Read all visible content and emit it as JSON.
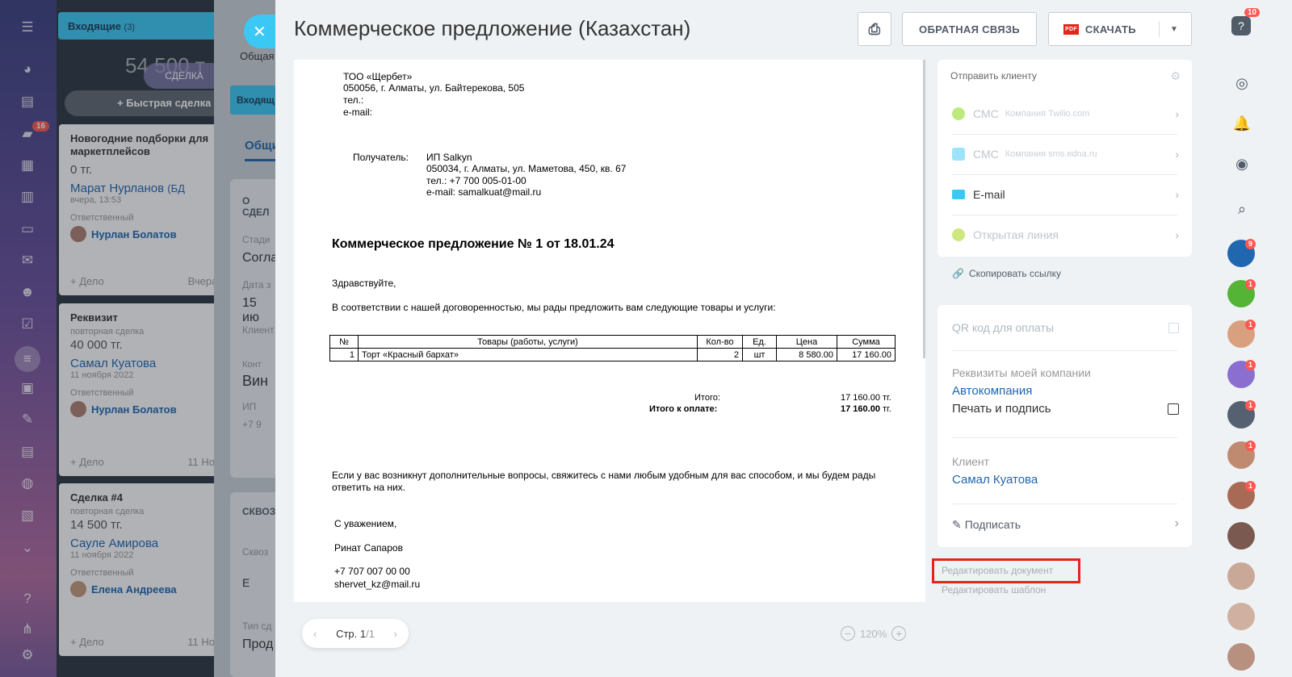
{
  "nav": {
    "chat_badge": "16"
  },
  "kanban": {
    "column_title": "Входящие",
    "column_count": "(3)",
    "sum": "54 500 т",
    "sum_pill": "СДЕЛКА",
    "quick_add": "+ Быстрая сделка",
    "cards": [
      {
        "title": "Новогодние подборки для маркетплейсов",
        "sub": "",
        "price": "0 тг.",
        "client": "Марат Нурланов",
        "client_extra": "(БД",
        "date": "вчера, 13:53",
        "resp_label": "Ответственный",
        "resp": "Нурлан Болатов",
        "footer_left": "+ Дело",
        "footer_right": "Вчера,"
      },
      {
        "title": "Реквизит",
        "sub": "повторная сделка",
        "price": "40 000 тг.",
        "client": "Самал Куатова",
        "client_extra": "",
        "date": "11 ноября 2022",
        "resp_label": "Ответственный",
        "resp": "Нурлан Болатов",
        "footer_left": "+ Дело",
        "footer_right": "11 Ноя"
      },
      {
        "title": "Сделка #4",
        "sub": "повторная сделка",
        "price": "14 500 тг.",
        "client": "Сауле Амирова",
        "client_extra": "",
        "date": "11 ноября 2022",
        "resp_label": "Ответственный",
        "resp": "Елена Андреева",
        "footer_left": "+ Дело",
        "footer_right": "11 Ноя"
      }
    ]
  },
  "middle": {
    "close": "✕",
    "general": "Общая",
    "tab_btn": "Входящ",
    "tab_active": "Общи",
    "about": "О СДЕЛ",
    "stage_label": "Стади",
    "stage_val": "Согла",
    "date_label": "Дата з",
    "date_val": "15 ию",
    "client_label": "Клиент",
    "contact_label": "Конт",
    "contact_val": "Вин",
    "ip": "ИП",
    "phone": "+7 9",
    "through": "СКВОЗ",
    "through_label": "Сквоз",
    "through_val": "E",
    "type_label": "Тип сд",
    "type_val": "Прод"
  },
  "slider": {
    "title": "Коммерческое предложение (Казахстан)",
    "feedback": "ОБРАТНАЯ СВЯЗЬ",
    "download": "СКАЧАТЬ",
    "pdf": "PDF"
  },
  "document": {
    "company": "ТОО «Щербет»",
    "address": "050056, г. Алматы, ул. Байтерекова, 505",
    "tel": "тел.:",
    "email": "e-mail:",
    "recipient_label": "Получатель:",
    "recipient_name": "ИП Salkyn",
    "recipient_address": "050034, г. Алматы, ул. Маметова,  450, кв. 67",
    "recipient_tel": "тел.: +7 700 005-01-00",
    "recipient_email": "e-mail: samalkuat@mail.ru",
    "heading": "Коммерческое предложение № 1 от 18.01.24",
    "greeting": "Здравствуйте,",
    "intro": "В соответствии с нашей договоренностью, мы рады предложить вам следующие товары и услуги:",
    "table_headers": [
      "№",
      "Товары (работы, услуги)",
      "Кол-во",
      "Ед.",
      "Цена",
      "Сумма"
    ],
    "table_rows": [
      [
        "1",
        "Торт «Красный бархат»",
        "2",
        "шт",
        "8 580.00",
        "17 160.00"
      ]
    ],
    "total_label": "Итого:",
    "total_value": "17 160.00 тг.",
    "topay_label": "Итого к оплате:",
    "topay_value": "17 160.00",
    "topay_unit": "тг.",
    "questions": "Если у вас возникнут дополнительные вопросы, свяжитесь с нами любым удобным для вас способом, и мы будем рады ответить на них.",
    "regards": "С уважением,",
    "signer": "Ринат Сапаров",
    "signer_phone": "+7 707 007 00 00",
    "signer_email": "shervet_kz@mail.ru"
  },
  "send": {
    "header": "Отправить клиенту",
    "items": [
      {
        "label": "СМС",
        "sub": "Компания Twilio.com",
        "color": "#7bd500"
      },
      {
        "label": "СМС",
        "sub": "Компания sms.edna.ru",
        "color": "#3bc8f5"
      },
      {
        "label": "E-mail",
        "sub": "",
        "color": "#3bc8f5"
      },
      {
        "label": "Открытая линия",
        "sub": "",
        "color": "#9dcf00"
      }
    ],
    "copy_link": "Скопировать ссылку"
  },
  "options": {
    "qr": "QR код для оплаты",
    "requisites_label": "Реквизиты моей компании",
    "requisites_value": "Автокомпания",
    "stamp": "Печать и подпись",
    "client_label": "Клиент",
    "client_value": "Самал Куатова",
    "sign": "Подписать"
  },
  "links": {
    "edit_document": "Редактировать документ",
    "edit_template": "Редактировать шаблон"
  },
  "pager": {
    "page_label": "Стр. 1",
    "page_total": "/1",
    "zoom": "120%"
  },
  "right": {
    "help_badge": "10",
    "badges": [
      "9",
      "1",
      "1",
      "1",
      "1",
      "1",
      "1"
    ]
  }
}
